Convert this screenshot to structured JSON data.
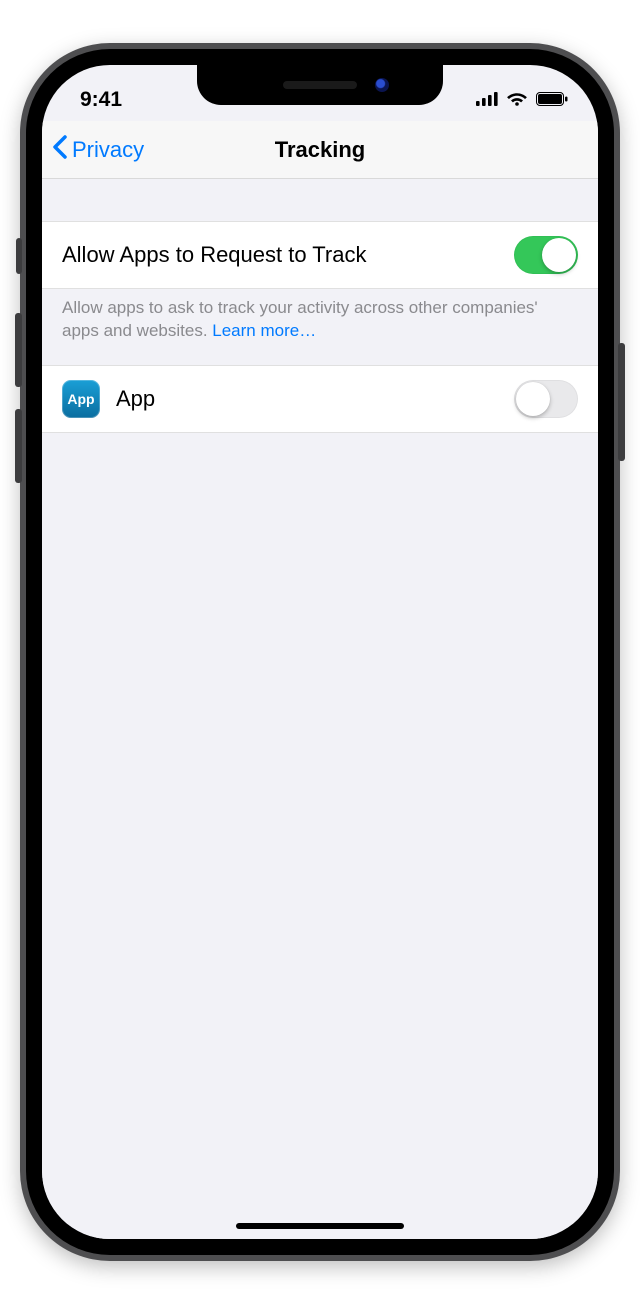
{
  "status": {
    "time": "9:41"
  },
  "nav": {
    "back_label": "Privacy",
    "title": "Tracking"
  },
  "main_toggle": {
    "label": "Allow Apps to Request to Track",
    "on": true
  },
  "footer": {
    "text": "Allow apps to ask to track your activity across other companies' apps and websites. ",
    "link_text": "Learn more…"
  },
  "apps": [
    {
      "name": "App",
      "icon_text": "App",
      "on": false
    }
  ]
}
